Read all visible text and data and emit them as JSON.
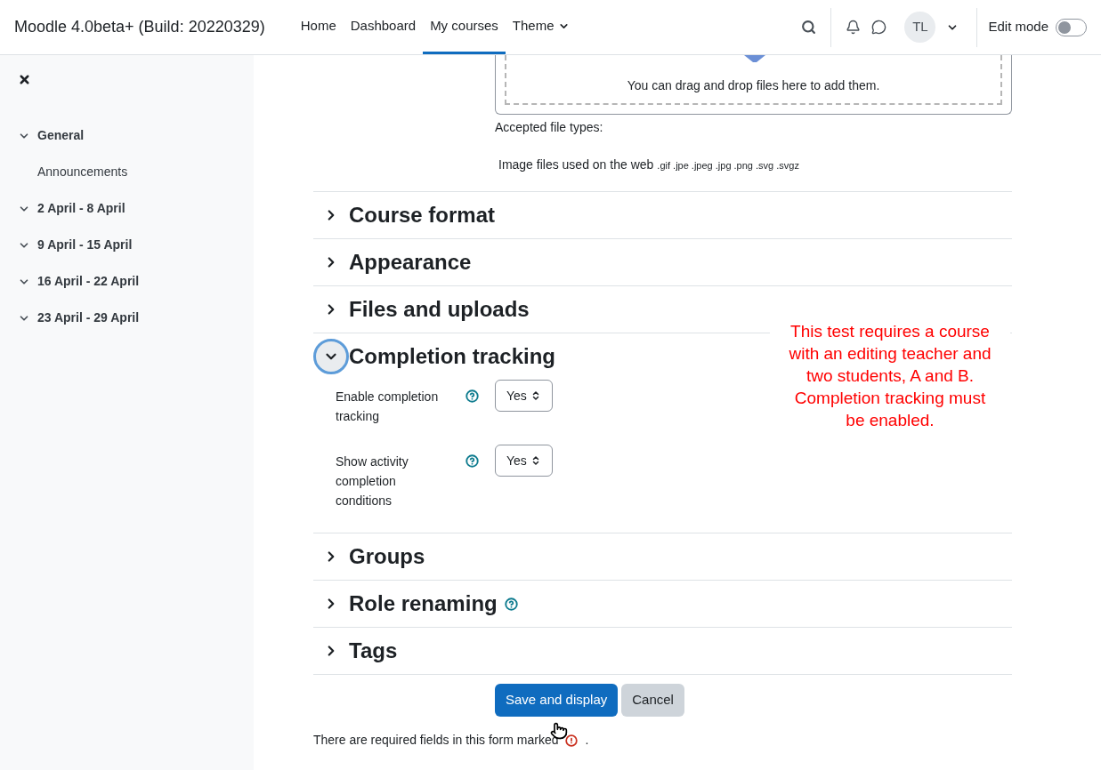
{
  "navbar": {
    "site_name": "Moodle 4.0beta+ (Build: 20220329)",
    "nav_items": [
      {
        "label": "Home",
        "selected": false,
        "dropdown": false
      },
      {
        "label": "Dashboard",
        "selected": false,
        "dropdown": false
      },
      {
        "label": "My courses",
        "selected": true,
        "dropdown": false
      },
      {
        "label": "Theme",
        "selected": false,
        "dropdown": true
      }
    ],
    "user_initials": "TL",
    "edit_mode": {
      "label": "Edit mode",
      "on": false
    }
  },
  "sidebar": {
    "sections": [
      {
        "title": "General",
        "expanded": true,
        "children": [
          {
            "title": "Announcements"
          }
        ]
      },
      {
        "title": "2 April - 8 April",
        "expanded": true
      },
      {
        "title": "9 April - 15 April",
        "expanded": true
      },
      {
        "title": "16 April - 22 April",
        "expanded": true
      },
      {
        "title": "23 April - 29 April",
        "expanded": true
      }
    ]
  },
  "filepicker": {
    "drop_text": "You can drag and drop files here to add them.",
    "accepted_label": "Accepted file types:",
    "type_name": "Image files used on the web",
    "extensions": ".gif .jpe .jpeg .jpg .png .svg .svgz"
  },
  "sections": [
    {
      "title": "Course format",
      "expanded": false,
      "focused": false,
      "help": false
    },
    {
      "title": "Appearance",
      "expanded": false,
      "focused": false,
      "help": false
    },
    {
      "title": "Files and uploads",
      "expanded": false,
      "focused": false,
      "help": false
    },
    {
      "title": "Completion tracking",
      "expanded": true,
      "focused": true,
      "help": false,
      "fields": [
        {
          "label": "Enable completion tracking",
          "value": "Yes"
        },
        {
          "label": "Show activity completion conditions",
          "value": "Yes"
        }
      ]
    },
    {
      "title": "Groups",
      "expanded": false,
      "focused": false,
      "help": false
    },
    {
      "title": "Role renaming",
      "expanded": false,
      "focused": false,
      "help": true
    },
    {
      "title": "Tags",
      "expanded": false,
      "focused": false,
      "help": false
    }
  ],
  "buttons": [
    {
      "label": "Save and display",
      "kind": "primary"
    },
    {
      "label": "Cancel",
      "kind": "secondary"
    }
  ],
  "required_note": "There are required fields in this form marked",
  "required_note_end": ".",
  "annotation": "This test requires a course with an editing teacher and two students, A and B. Completion tracking must be enabled."
}
